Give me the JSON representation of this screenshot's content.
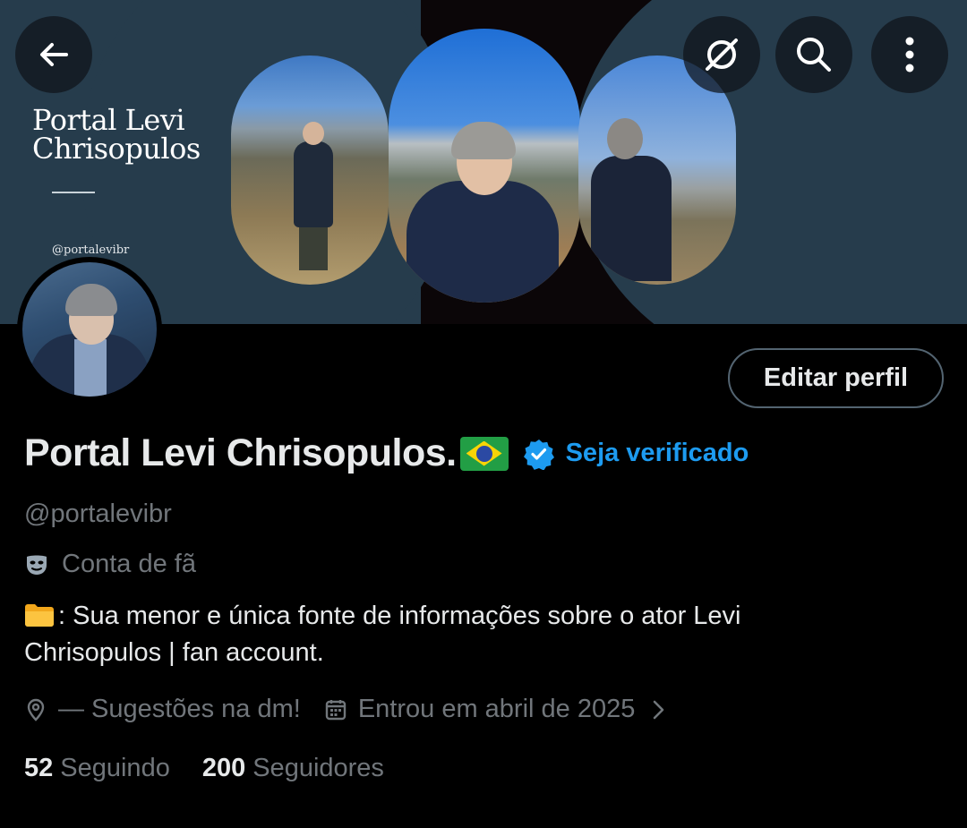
{
  "banner": {
    "title_line1": "Portal Levi",
    "title_line2": "Chrisopulos",
    "handle": "@portalevibr"
  },
  "actions": {
    "back_icon": "arrow-left-icon",
    "grok_icon": "grok-icon",
    "search_icon": "search-icon",
    "more_icon": "more-vertical-icon"
  },
  "profile": {
    "display_name": "Portal Levi Chrisopulos.",
    "flag_emoji": "🇧🇷",
    "verify_link": "Seja verificado",
    "handle": "@portalevibr",
    "category": "Conta de fã",
    "bio_line1": ": Sua menor e única fonte de informações sobre o ator Levi",
    "bio_line2": "Chrisopulos | fan account.",
    "location": "— Sugestões na dm!",
    "joined": "Entrou em abril de 2025",
    "following_count": "52",
    "following_label": "Seguindo",
    "followers_count": "200",
    "followers_label": "Seguidores"
  },
  "edit_button": {
    "label": "Editar perfil"
  },
  "colors": {
    "accent": "#1d9bf0",
    "muted": "#71767b",
    "text": "#e7e9ea",
    "banner": "#263c4c"
  }
}
